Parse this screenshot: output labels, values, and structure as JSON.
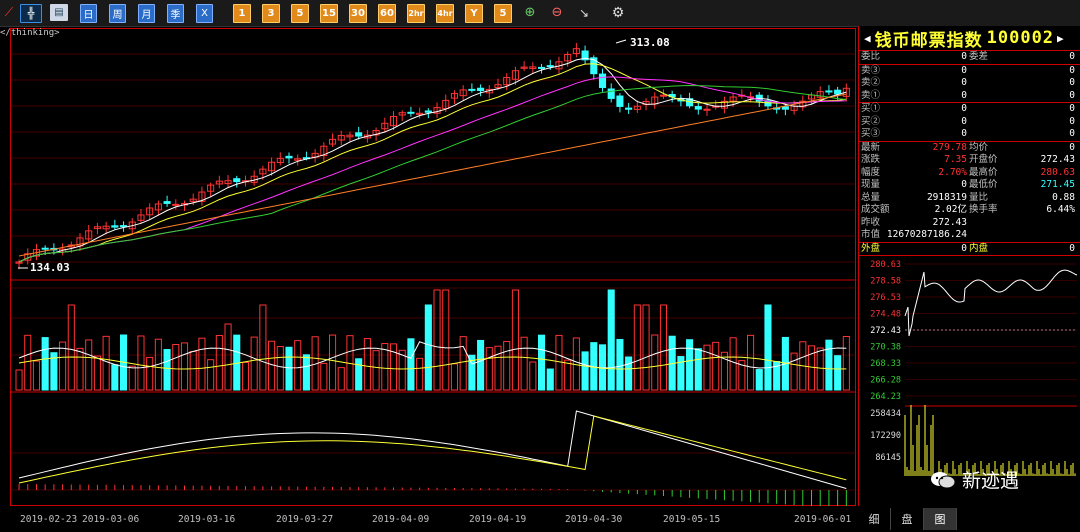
{
  "toolbar": {
    "buttons": [
      "日",
      "周",
      "月",
      "季",
      "X",
      "1",
      "3",
      "5",
      "15",
      "30",
      "60",
      "2hr",
      "4hr",
      "Y",
      "5",
      "",
      "",
      ""
    ]
  },
  "chart": {
    "y_axis_fragment": "</thinking>",
    "max_label": "313.08",
    "min_label": "134.03",
    "price_scale_min": 130,
    "price_scale_max": 320
  },
  "date_labels": [
    "2019-02-23",
    "2019-03-06",
    "2019-03-16",
    "2019-03-27",
    "2019-04-09",
    "2019-04-19",
    "2019-04-30",
    "2019-05-15",
    "2019-06-01"
  ],
  "panel": {
    "title": "钱币邮票指数",
    "code": "100002",
    "rows_top": [
      {
        "l": "委比",
        "v1": "0",
        "l2": "委差",
        "v2": "0"
      }
    ],
    "asks": [
      {
        "l": "卖③",
        "v1": "0",
        "v2": "0"
      },
      {
        "l": "卖②",
        "v1": "0",
        "v2": "0"
      },
      {
        "l": "卖①",
        "v1": "0",
        "v2": "0"
      }
    ],
    "bids": [
      {
        "l": "买①",
        "v1": "0",
        "v2": "0"
      },
      {
        "l": "买②",
        "v1": "0",
        "v2": "0"
      },
      {
        "l": "买③",
        "v1": "0",
        "v2": "0"
      }
    ],
    "quote": [
      {
        "l": "最新",
        "v1": "279.78",
        "c1": "red",
        "l2": "均价",
        "v2": "0",
        "c2": "white"
      },
      {
        "l": "涨跌",
        "v1": "7.35",
        "c1": "red",
        "l2": "开盘价",
        "v2": "272.43",
        "c2": "white"
      },
      {
        "l": "幅度",
        "v1": "2.70%",
        "c1": "red",
        "l2": "最高价",
        "v2": "280.63",
        "c2": "red"
      },
      {
        "l": "现量",
        "v1": "0",
        "c1": "white",
        "l2": "最低价",
        "v2": "271.45",
        "c2": "cyan"
      },
      {
        "l": "总量",
        "v1": "2918319",
        "c1": "white",
        "l2": "量比",
        "v2": "0.88",
        "c2": "white"
      },
      {
        "l": "成交额",
        "v1": "2.02亿",
        "c1": "white",
        "l2": "换手率",
        "v2": "6.44%",
        "c2": "white"
      },
      {
        "l": "昨收",
        "v1": "272.43",
        "c1": "white",
        "l2": "",
        "v2": "",
        "c2": "white"
      },
      {
        "l": "市值",
        "v1": "12670287186.24",
        "c1": "white",
        "l2": "",
        "v2": "",
        "c2": "white"
      }
    ],
    "outer": {
      "l": "外盘",
      "v1": "0",
      "l2": "内盘",
      "v2": "0"
    },
    "mini_prices": [
      "280.63",
      "278.58",
      "276.53",
      "274.48",
      "272.43",
      "270.38",
      "268.33",
      "266.28",
      "264.23"
    ],
    "mini_vols": [
      "258434",
      "172290",
      "86145"
    ]
  },
  "bottom_tabs": [
    "细",
    "盘",
    "图"
  ],
  "watermark": "新迹遇"
}
